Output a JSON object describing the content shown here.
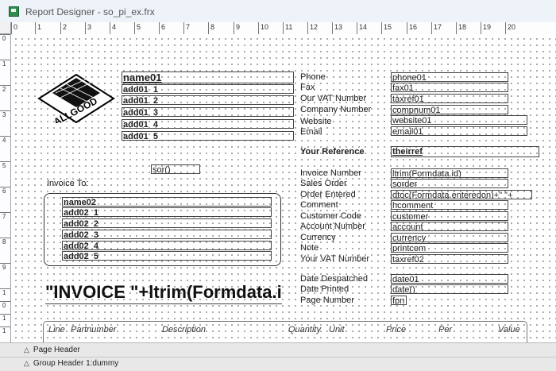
{
  "window": {
    "title": "Report Designer - so_pi_ex.frx"
  },
  "ruler": {
    "horizontal": [
      "0",
      "1",
      "2",
      "3",
      "4",
      "5",
      "6",
      "7",
      "8",
      "9",
      "10",
      "11",
      "12",
      "13",
      "14",
      "15",
      "16",
      "17",
      "18",
      "19",
      "20"
    ],
    "vertical": [
      "0",
      "1",
      "2",
      "3",
      "4",
      "5",
      "6",
      "7",
      "8",
      "9",
      "1",
      "0",
      "1",
      "1"
    ]
  },
  "logo": {
    "text": "ALLGOOD"
  },
  "address1": [
    "name01",
    "add01_1",
    "add01_2",
    "add01_3",
    "add01_4",
    "add01_5"
  ],
  "sor": "sor()",
  "invoice_to": "Invoice To:",
  "address2": [
    "name02",
    "add02_1",
    "add02_2",
    "add02_3",
    "add02_4",
    "add02_5"
  ],
  "contact": [
    {
      "label": "Phone",
      "field": "phone01"
    },
    {
      "label": "Fax",
      "field": "fax01"
    },
    {
      "label": "Our VAT Number",
      "field": "taxref01"
    },
    {
      "label": "Company Number",
      "field": "compnum01"
    },
    {
      "label": "Website",
      "field": "website01"
    },
    {
      "label": "Email",
      "field": "email01"
    }
  ],
  "reference": {
    "label": "Your Reference",
    "field": "theirref"
  },
  "order": [
    {
      "label": "Invoice Number",
      "field": "ltrim(Formdata.id)"
    },
    {
      "label": "Sales Order",
      "field": "sorder"
    },
    {
      "label": "Order Entered",
      "field": "dtoc(Formdata.enteredon)+\" \"+"
    },
    {
      "label": "Comment",
      "field": "hcomment"
    },
    {
      "label": "Customer Code",
      "field": "customer"
    },
    {
      "label": "Account Number",
      "field": "account"
    },
    {
      "label": "Currency",
      "field": "currency"
    },
    {
      "label": "Note",
      "field": "printcom"
    },
    {
      "label": "Your VAT Number",
      "field": "taxref02"
    }
  ],
  "dates": [
    {
      "label": "Date Despatched",
      "field": "date01"
    },
    {
      "label": "Date Printed",
      "field": "date()"
    },
    {
      "label": "Page Number",
      "field": "fpn"
    }
  ],
  "big_expression": "\"INVOICE \"+ltrim(Formdata.id)",
  "columns": [
    "Line",
    "Partnumber",
    "Description",
    "Quantity",
    "Unit",
    "Price",
    "Per",
    "Value"
  ],
  "bands": [
    "Page Header",
    "Group Header 1:dummy"
  ]
}
